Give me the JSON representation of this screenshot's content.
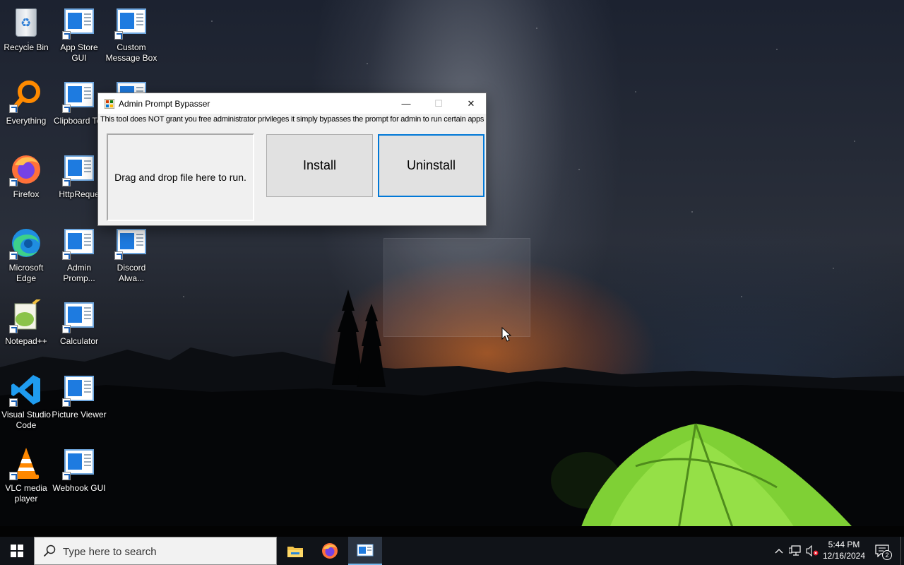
{
  "desktop": {
    "icons": [
      {
        "label": "Recycle Bin",
        "icon": "recycle-bin-icon"
      },
      {
        "label": "App Store GUI",
        "icon": "app-icon"
      },
      {
        "label": "Custom Message Box",
        "icon": "app-icon"
      },
      {
        "label": "Everything",
        "icon": "everything-search-icon"
      },
      {
        "label": "Clipboard To File",
        "icon": "app-icon"
      },
      {
        "label": "Firefox",
        "icon": "firefox-icon"
      },
      {
        "label": "HttpReque",
        "icon": "app-icon"
      },
      {
        "label": "Microsoft Edge",
        "icon": "edge-icon"
      },
      {
        "label": "Admin Promp...",
        "icon": "app-icon"
      },
      {
        "label": "Discord Alwa...",
        "icon": "app-icon"
      },
      {
        "label": "Notepad++",
        "icon": "notepadpp-icon"
      },
      {
        "label": "Calculator",
        "icon": "app-icon"
      },
      {
        "label": "Visual Studio Code",
        "icon": "vscode-icon"
      },
      {
        "label": "Picture Viewer",
        "icon": "app-icon"
      },
      {
        "label": "VLC media player",
        "icon": "vlc-icon"
      },
      {
        "label": "Webhook GUI",
        "icon": "app-icon"
      }
    ]
  },
  "window": {
    "title": "Admin Prompt Bypasser",
    "notice": "This tool does NOT grant you free administrator privileges it simply bypasses the prompt for admin to run certain apps",
    "dropzone_label": "Drag and drop file here to run.",
    "install_label": "Install",
    "uninstall_label": "Uninstall",
    "controls": {
      "minimize": "—",
      "maximize": "☐",
      "close": "✕"
    }
  },
  "taskbar": {
    "search_placeholder": "Type here to search",
    "apps": [
      "File Explorer",
      "Firefox",
      "Admin Prompt Bypasser"
    ],
    "clock_time": "5:44 PM",
    "clock_date": "12/16/2024",
    "notification_count": "2"
  },
  "colors": {
    "accent": "#0078d7",
    "taskbar": "#101318",
    "window_bg": "#f0f0f0",
    "button_bg": "#e1e1e1"
  }
}
